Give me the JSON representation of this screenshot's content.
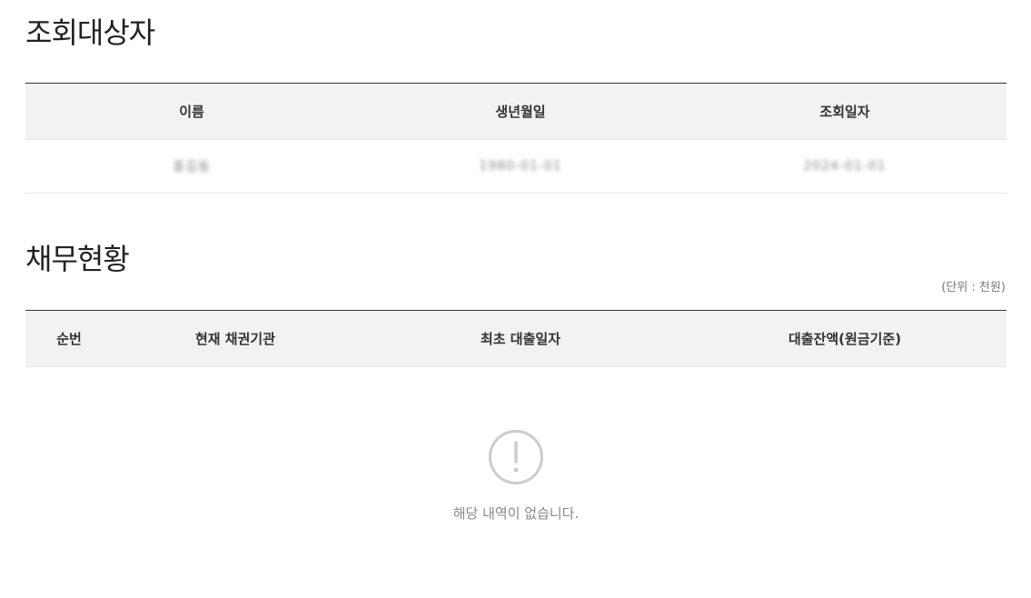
{
  "subject_section": {
    "title": "조회대상자",
    "headers": [
      "이름",
      "생년월일",
      "조회일자"
    ],
    "row": [
      "홍길동",
      "1980-01-01",
      "2024-01-01"
    ]
  },
  "debt_section": {
    "title": "채무현황",
    "unit_note": "(단위 : 천원)",
    "headers": [
      "순번",
      "현재 채권기관",
      "최초 대출일자",
      "대출잔액(원금기준)"
    ],
    "empty_message": "해당 내역이 없습니다.",
    "empty_icon": "alert-circle-icon"
  }
}
